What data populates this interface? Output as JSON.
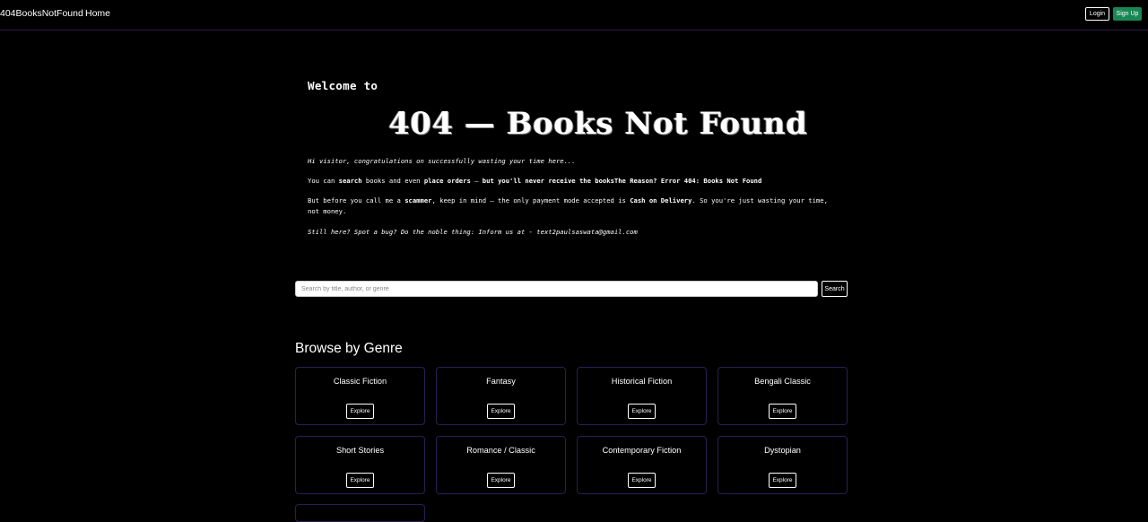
{
  "nav": {
    "brand": "404BooksNotFound",
    "home": "Home",
    "login": "Login",
    "signup": "Sign Up"
  },
  "hero": {
    "welcome": "Welcome to",
    "title": "404 — Books Not Found",
    "p1": "Hi visitor, congratulations on successfully wasting your time here...",
    "p2": {
      "a": "You can ",
      "b": "search",
      "c": " books and even ",
      "d": "place orders",
      "e": " — ",
      "f": "but you'll never receive the booksThe Reason? Error 404: Books Not Found"
    },
    "p3": {
      "a": "But before you call me a ",
      "b": "scammer",
      "c": ", keep in mind — the only payment mode accepted is ",
      "d": "Cash on Delivery",
      "e": ". So you're just wasting your time, not money."
    },
    "p4": "Still here? Spot a bug? Do the noble thing: Inform us at - text2paulsaswata@gmail.com"
  },
  "search": {
    "placeholder": "Search by title, author, or genre",
    "value": "",
    "button": "Search"
  },
  "genres": {
    "heading": "Browse by Genre",
    "explore_label": "Explore",
    "items": [
      {
        "name": "Classic Fiction"
      },
      {
        "name": "Fantasy"
      },
      {
        "name": "Historical Fiction"
      },
      {
        "name": "Bengali Classic"
      },
      {
        "name": "Short Stories"
      },
      {
        "name": "Romance / Classic"
      },
      {
        "name": "Contemporary Fiction"
      },
      {
        "name": "Dystopian"
      }
    ]
  },
  "colors": {
    "background": "#000000",
    "accent_green": "#198754",
    "card_border": "#2a1f52",
    "nav_border": "#2e1a4a"
  }
}
